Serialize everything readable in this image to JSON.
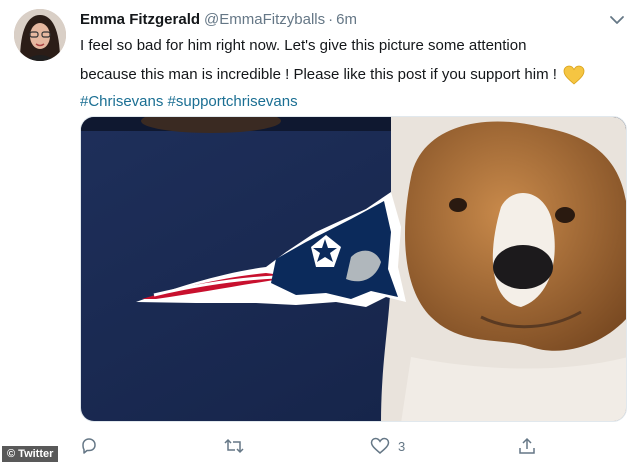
{
  "tweet": {
    "author_name": "Emma Fitzgerald",
    "author_handle": "@EmmaFitzyballs",
    "separator": "·",
    "timestamp": "6m",
    "text_line1": "I feel so bad for him right now. Let's give this picture some attention",
    "text_line2": "because this man is incredible ! Please like this post if you support him !",
    "hashtags": [
      "#Chrisevans",
      "#supportchrisevans"
    ],
    "emoji": "yellow-heart",
    "media_description_icon": "photo"
  },
  "actions": {
    "reply_count": "",
    "retweet_count": "",
    "like_count": "3",
    "share_count": ""
  },
  "watermark": "© Twitter",
  "colors": {
    "link": "#1b6f93",
    "secondary_text": "#657786",
    "primary_text": "#14171a",
    "heart": "#f5c542"
  }
}
